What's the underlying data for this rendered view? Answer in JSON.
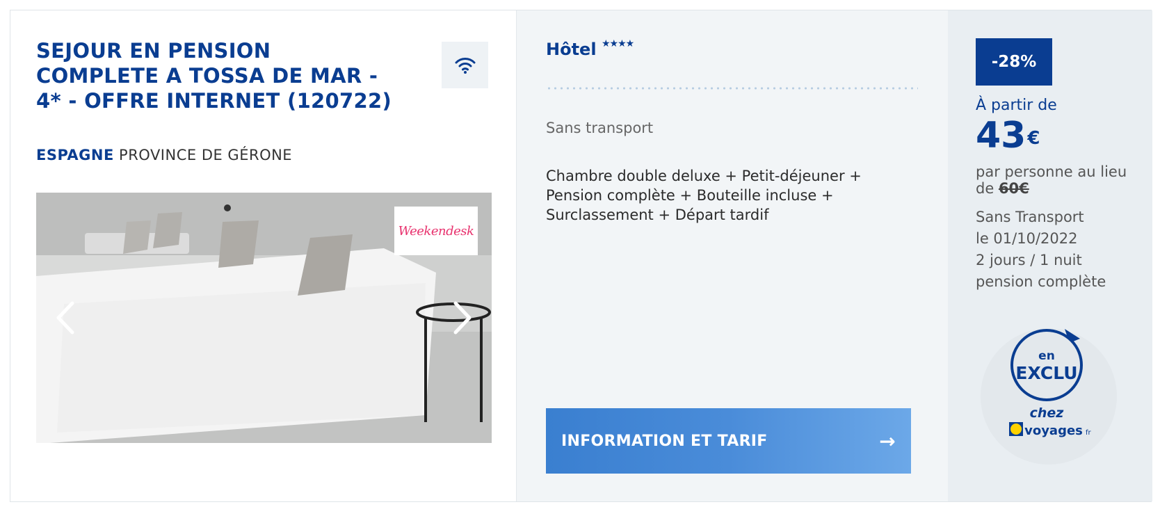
{
  "offer": {
    "title": "SEJOUR EN PENSION COMPLETE A TOSSA DE MAR - 4* - OFFRE INTERNET (120722)",
    "country": "ESPAGNE",
    "region": "PROVINCE DE GÉRONE",
    "partner_logo": "Weekendesk",
    "amenity_icon": "wifi-icon"
  },
  "details": {
    "hotel_label": "Hôtel",
    "stars": "★★★★",
    "transport": "Sans transport",
    "description": "Chambre double deluxe + Petit-déjeuner + Pension complète + Bouteille incluse + Surclassement + Départ tardif",
    "cta_label": "INFORMATION ET TARIF",
    "cta_arrow": "→"
  },
  "pricing": {
    "discount": "-28%",
    "from_label": "À partir de",
    "price": "43",
    "currency": "€",
    "per_person": "par personne au lieu de",
    "old_price": "60€",
    "transport": "Sans Transport",
    "date": "le 01/10/2022",
    "duration": "2 jours / 1 nuit",
    "board": "pension complète"
  },
  "badge": {
    "line1": "en",
    "line2": "EXCLU",
    "line3": "chez",
    "brand": "voyages",
    "brand_suffix": "fr"
  },
  "colors": {
    "primary": "#0a3d91",
    "cta_start": "#3a7fd0",
    "cta_end": "#6ca8e8",
    "partner": "#e8326e"
  }
}
